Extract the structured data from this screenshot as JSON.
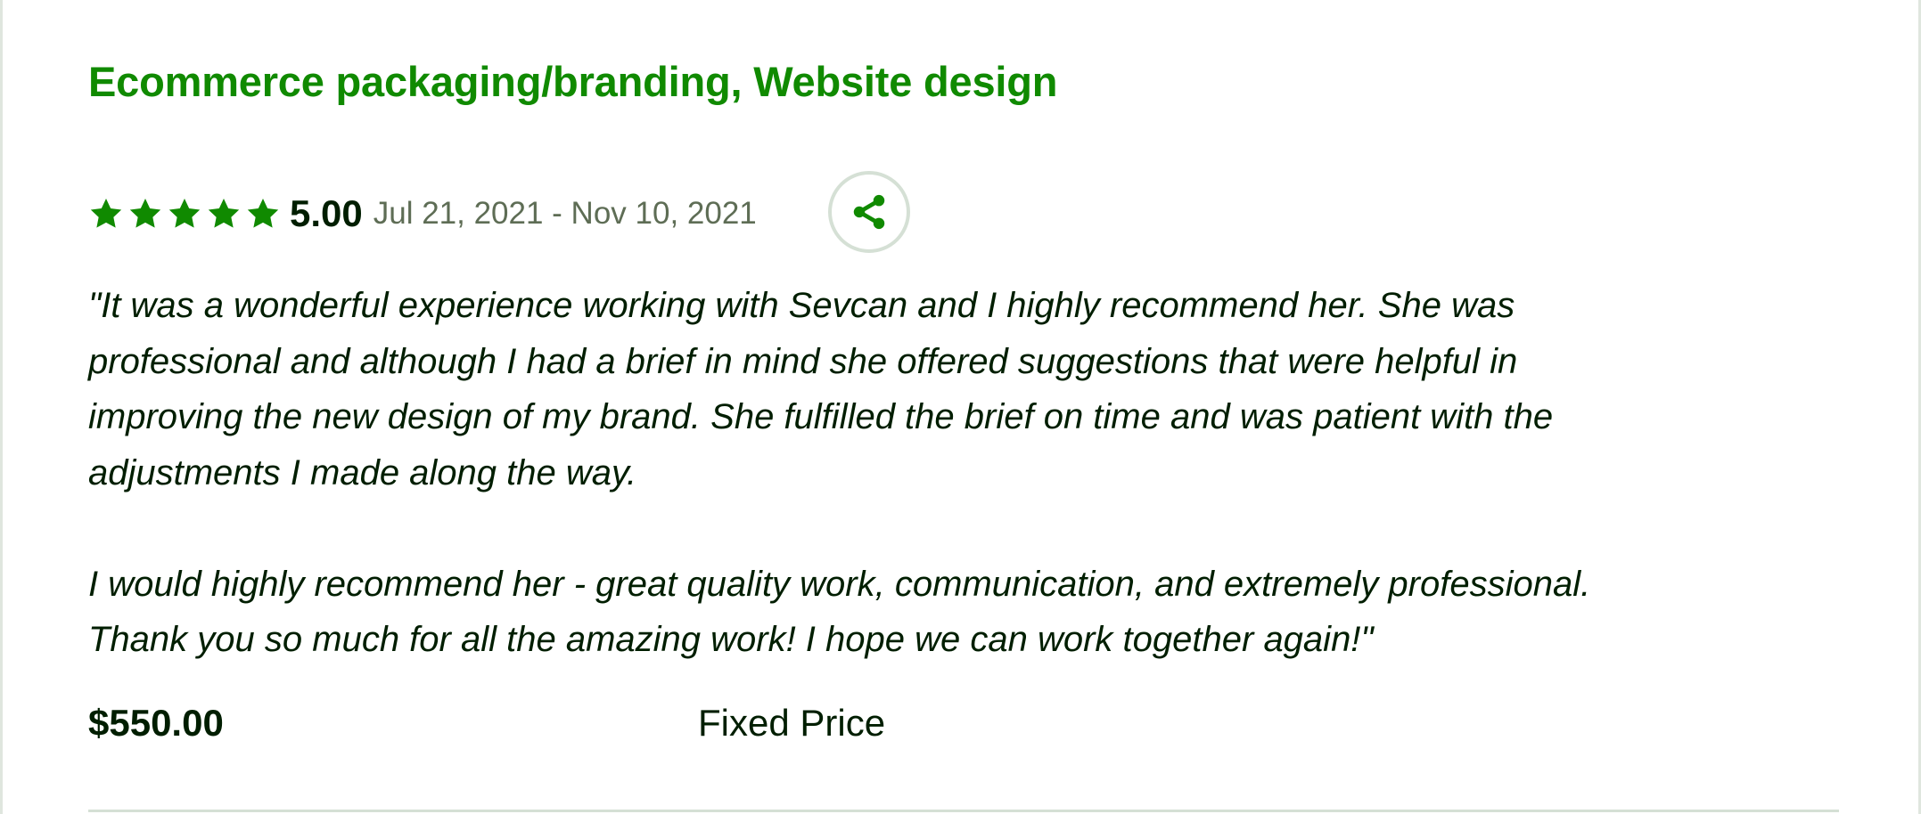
{
  "job": {
    "title": "Ecommerce packaging/branding, Website design",
    "rating": {
      "stars": 5,
      "max_stars": 5,
      "score": "5.00",
      "date_range": "Jul 21, 2021 - Nov 10, 2021"
    },
    "share_icon": "share-icon",
    "review_paragraphs": [
      [
        "\"It was a wonderful experience working with Sevcan and I highly recommend her. She was",
        "professional and although I had a brief in mind she offered suggestions that were helpful in",
        "improving the new design of my brand. She fulfilled the brief on time and was patient with the",
        "adjustments I made along the way."
      ],
      [
        "I would highly recommend her - great quality work, communication, and extremely professional.",
        "Thank you so much for all the amazing work! I hope we can work together again!\""
      ]
    ],
    "price": "$550.00",
    "price_type": "Fixed Price"
  },
  "colors": {
    "title": "#108a00",
    "star": "#108a00",
    "text": "#001e00",
    "muted": "#5e6d55",
    "border": "#d5e0d5"
  }
}
